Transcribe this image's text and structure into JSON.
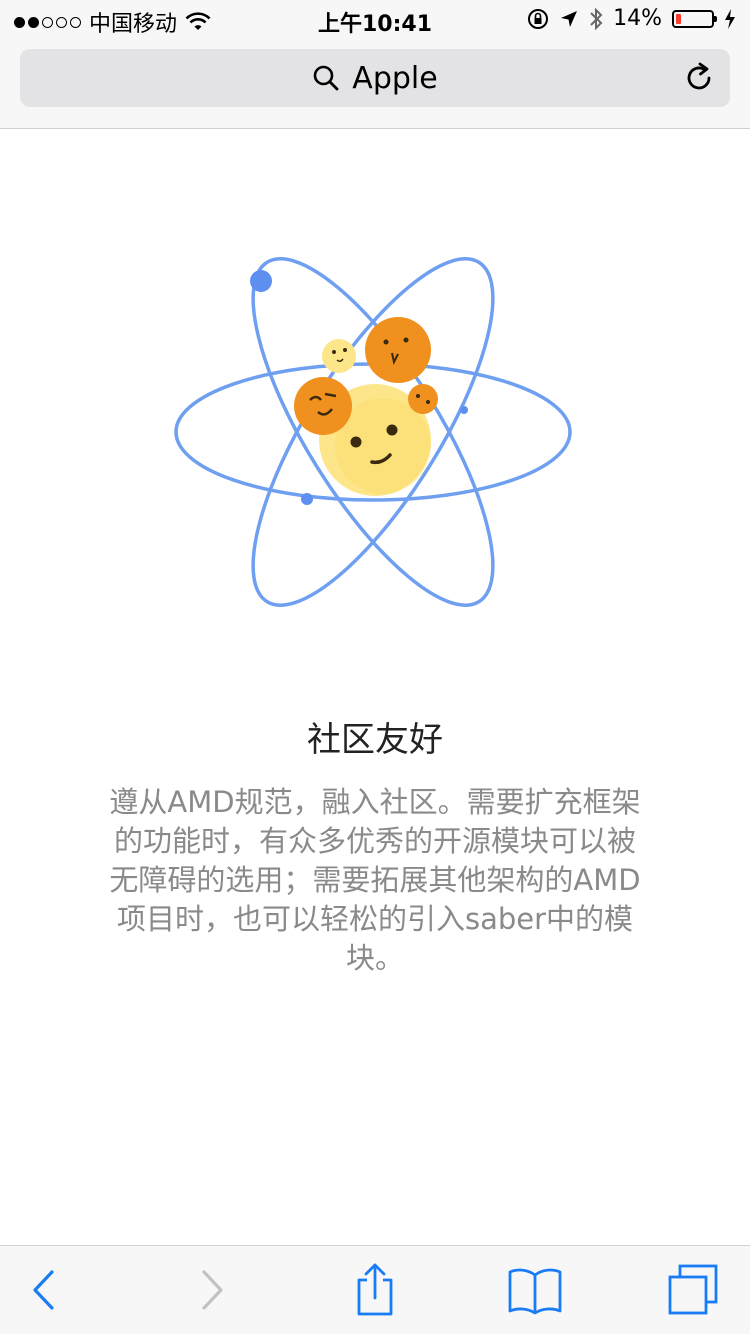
{
  "status_bar": {
    "carrier": "中国移动",
    "time": "上午10:41",
    "battery_percent": "14%",
    "battery_level": 0.14,
    "signal_bars_filled": 2,
    "signal_bars_total": 5,
    "icons": [
      "wifi-icon",
      "orientation-lock-icon",
      "location-icon",
      "bluetooth-icon",
      "charging-icon"
    ]
  },
  "address_bar": {
    "text": "Apple",
    "search_icon": "search-icon",
    "reload_icon": "reload-icon"
  },
  "content": {
    "illustration": "atom-emoji-illustration",
    "title": "社区友好",
    "description": "遵从AMD规范，融入社区。需要扩充框架的功能时，有众多优秀的开源模块可以被无障碍的选用；需要拓展其他架构的AMD项目时，也可以轻松的引入saber中的模块。"
  },
  "toolbar": {
    "items": [
      "back-icon",
      "forward-icon",
      "share-icon",
      "bookmarks-icon",
      "tabs-icon"
    ]
  },
  "colors": {
    "accent_blue": "#1a7cf5",
    "orbit_blue": "#6f9ff0",
    "orange": "#f0901e",
    "yellow": "#fde68a",
    "battery_red": "#ff3b30",
    "text_gray": "#8a8a8a"
  }
}
